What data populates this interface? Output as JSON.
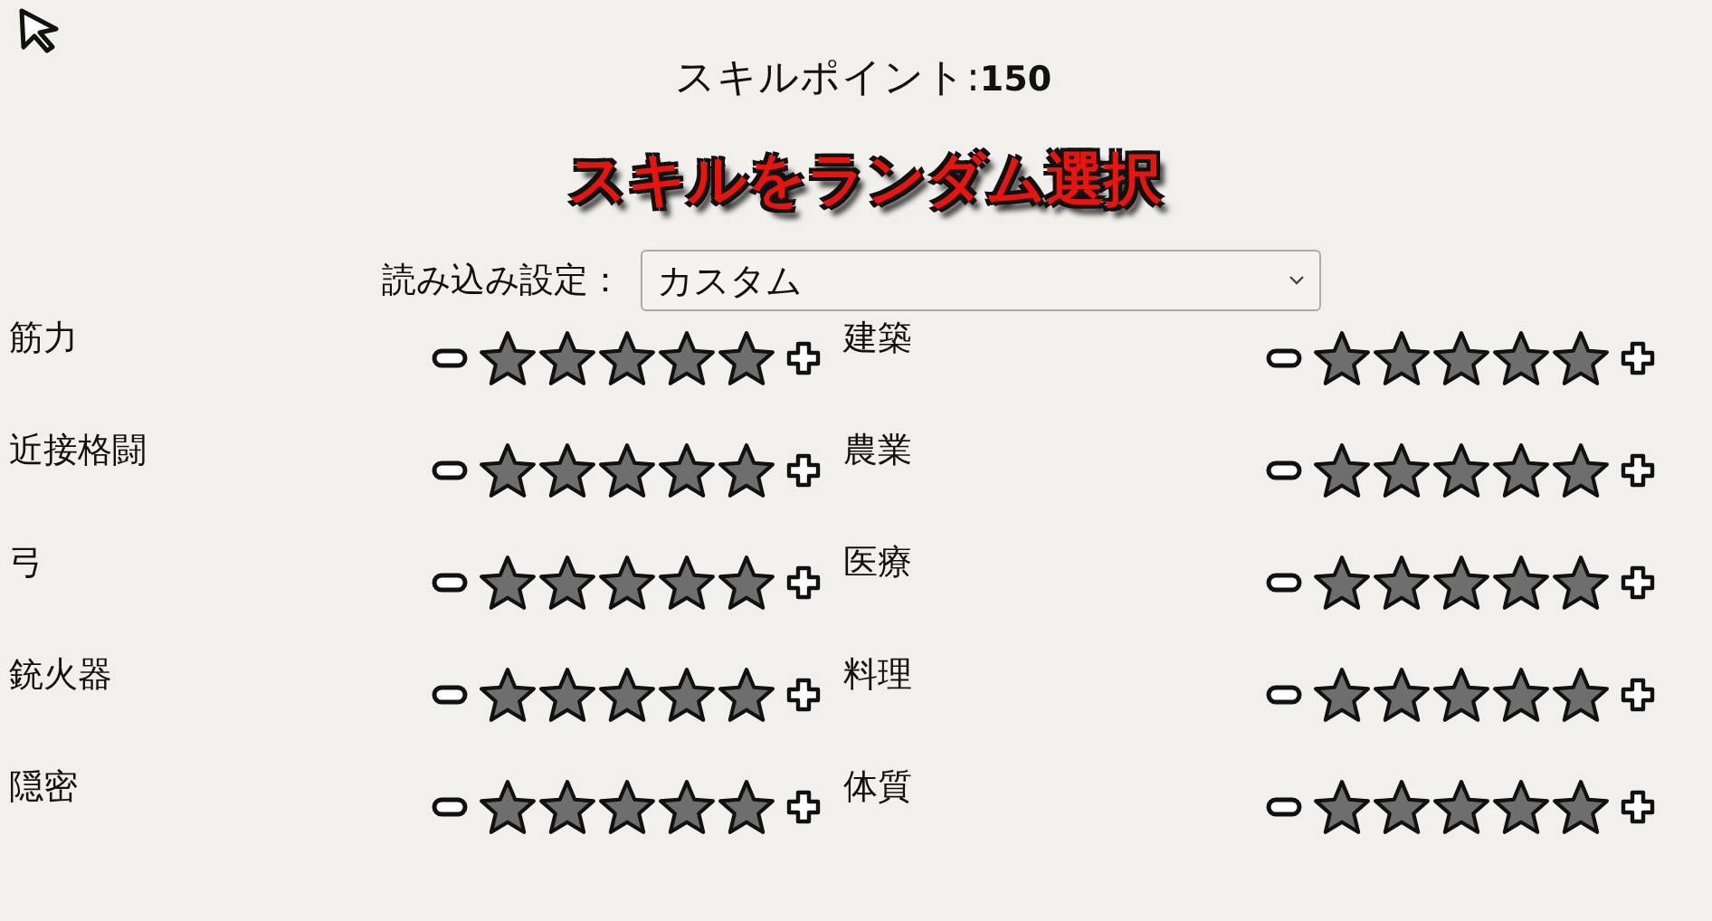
{
  "skill_points": {
    "label": "スキルポイント:",
    "value": "150"
  },
  "random_button": "スキルをランダム選択",
  "preset": {
    "label": "読み込み設定：",
    "value": "カスタム"
  },
  "skills": [
    {
      "name": "筋力",
      "stars": 5
    },
    {
      "name": "建築",
      "stars": 5
    },
    {
      "name": "近接格闘",
      "stars": 5
    },
    {
      "name": "農業",
      "stars": 5
    },
    {
      "name": "弓",
      "stars": 5
    },
    {
      "name": "医療",
      "stars": 5
    },
    {
      "name": "銃火器",
      "stars": 5
    },
    {
      "name": "料理",
      "stars": 5
    },
    {
      "name": "隠密",
      "stars": 5
    },
    {
      "name": "体質",
      "stars": 5
    }
  ]
}
